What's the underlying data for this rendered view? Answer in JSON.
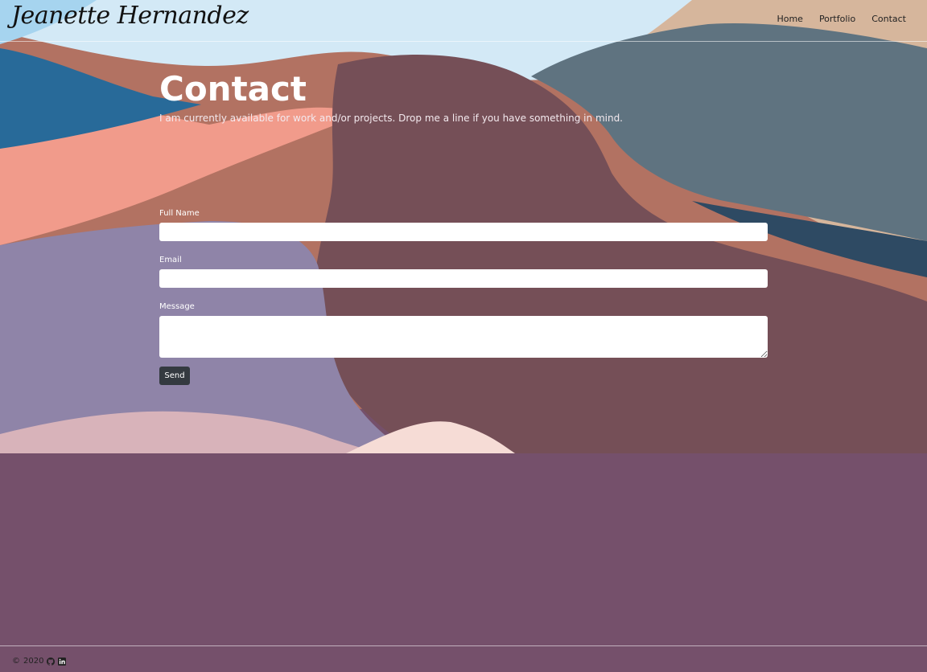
{
  "brand": {
    "name": "Jeanette Hernandez"
  },
  "nav": {
    "items": [
      "Home",
      "Portfolio",
      "Contact"
    ]
  },
  "hero": {
    "title": "Contact",
    "subtitle": "I am currently available for work and/or projects. Drop me a line if you have something in mind."
  },
  "form": {
    "full_name_label": "Full Name",
    "full_name_value": "",
    "email_label": "Email",
    "email_value": "",
    "message_label": "Message",
    "message_value": "",
    "send_label": "Send"
  },
  "footer": {
    "copyright_symbol": "©",
    "year": "2020"
  },
  "icons": [
    "github-icon",
    "linkedin-icon"
  ],
  "colors": {
    "button_bg": "#343a40",
    "field_bg": "#ffffff",
    "title": "#ffffff"
  }
}
